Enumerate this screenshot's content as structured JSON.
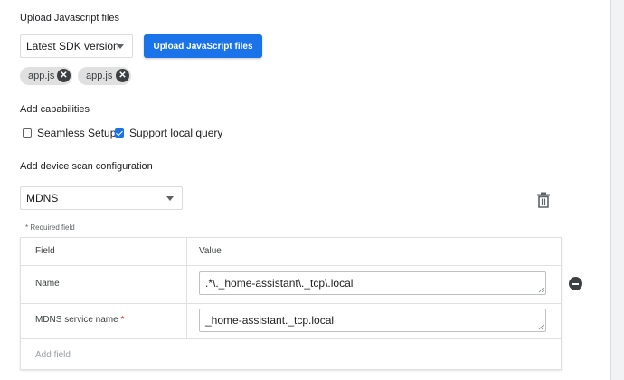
{
  "upload": {
    "title": "Upload Javascript files",
    "sdk_select_value": "Latest SDK version",
    "upload_button_label": "Upload JavaScript files",
    "files": [
      {
        "name": "app.js"
      },
      {
        "name": "app.js"
      }
    ]
  },
  "capabilities": {
    "title": "Add capabilities",
    "options": [
      {
        "label": "Seamless Setup",
        "checked": false
      },
      {
        "label": "Support local query",
        "checked": true
      }
    ]
  },
  "scan_config": {
    "title": "Add device scan configuration",
    "type_select_value": "MDNS",
    "required_note": "* Required field",
    "table": {
      "col_field": "Field",
      "col_value": "Value",
      "rows": [
        {
          "field": "Name",
          "required": false,
          "value": ".*\\._home-assistant\\._tcp\\.local"
        },
        {
          "field": "MDNS service name",
          "required": true,
          "value": "_home-assistant._tcp.local"
        }
      ],
      "required_marker": "*",
      "add_field_label": "Add field"
    }
  },
  "colors": {
    "accent": "#1a73e8",
    "required": "#d93025"
  }
}
